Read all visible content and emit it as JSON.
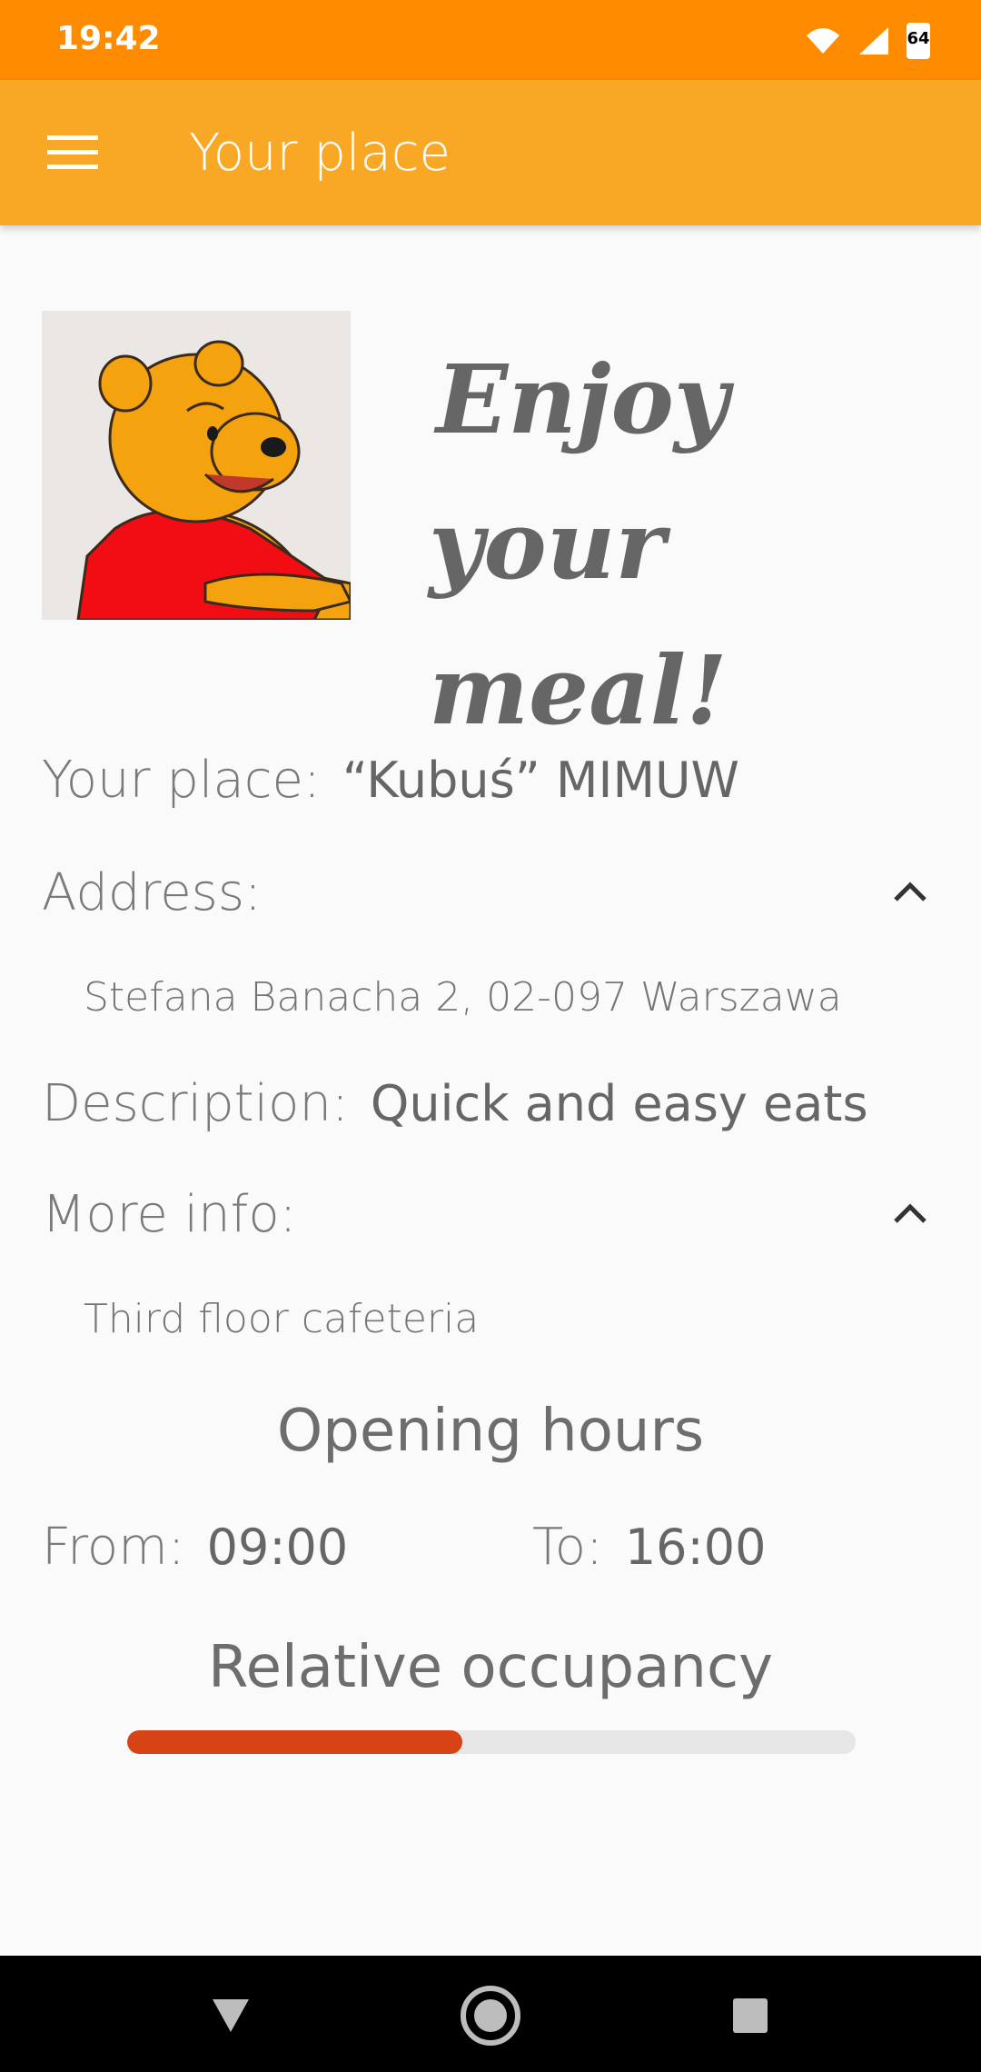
{
  "status_bar": {
    "time": "19:42",
    "battery": "64"
  },
  "app_bar": {
    "title": "Your place"
  },
  "hero": {
    "line1": "Enjoy",
    "line2": "your meal!"
  },
  "details": {
    "place_label": "Your place:",
    "place_value": "“Kubuś” MIMUW",
    "address_label": "Address:",
    "address_value": "Stefana Banacha 2, 02-097 Warszawa",
    "description_label": "Description:",
    "description_value": "Quick and easy eats",
    "more_info_label": "More info:",
    "more_info_value": "Third floor cafeteria"
  },
  "hours": {
    "title": "Opening hours",
    "from_label": "From:",
    "from_value": "09:00",
    "to_label": "To:",
    "to_value": "16:00"
  },
  "occupancy": {
    "title": "Relative occupancy",
    "level": 0.46,
    "color": "#d84315"
  },
  "colors": {
    "status_bar": "#ff8c00",
    "app_bar": "#f9a825"
  },
  "icons": [
    "wifi-icon",
    "signal-icon",
    "battery-icon",
    "menu-icon",
    "chevron-up-icon",
    "back-icon",
    "home-icon",
    "recents-icon"
  ]
}
